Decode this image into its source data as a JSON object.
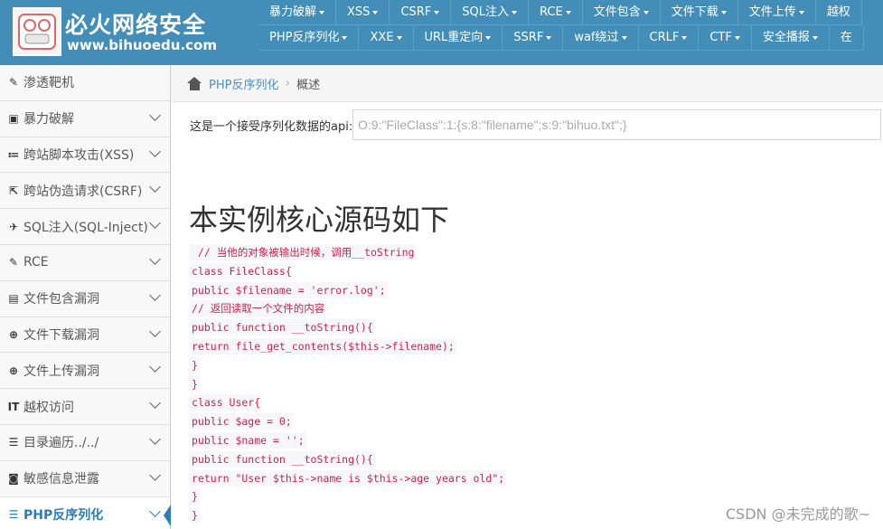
{
  "logo": {
    "title_cn": "必火网络安全",
    "url": "www.bihuoedu.com",
    "badge": "必火"
  },
  "top_nav": {
    "row1": [
      "暴力破解",
      "XSS",
      "CSRF",
      "SQL注入",
      "RCE",
      "文件包含",
      "文件下载",
      "文件上传",
      "越权"
    ],
    "row2": [
      "PHP反序列化",
      "XXE",
      "URL重定向",
      "SSRF",
      "waf绕过",
      "CRLF",
      "CTF",
      "安全播报",
      "在"
    ]
  },
  "sidebar": {
    "items": [
      {
        "label": "渗透靶机",
        "icon": "tag-icon",
        "glyph": "✎"
      },
      {
        "label": "暴力破解",
        "icon": "lock-icon",
        "glyph": "▣"
      },
      {
        "label": "跨站脚本攻击(XSS)",
        "icon": "list-icon",
        "glyph": "≔"
      },
      {
        "label": "跨站伪造请求(CSRF)",
        "icon": "external-link-icon",
        "glyph": "⇱"
      },
      {
        "label": "SQL注入(SQL-Inject)",
        "icon": "plane-icon",
        "glyph": "✈"
      },
      {
        "label": "RCE",
        "icon": "pencil-icon",
        "glyph": "✎"
      },
      {
        "label": "文件包含漏洞",
        "icon": "file-icon",
        "glyph": "▤"
      },
      {
        "label": "文件下载漏洞",
        "icon": "download-icon",
        "glyph": "⊕"
      },
      {
        "label": "文件上传漏洞",
        "icon": "upload-icon",
        "glyph": "⊕"
      },
      {
        "label": "越权访问",
        "icon": "text-icon",
        "glyph": "IT"
      },
      {
        "label": "目录遍历../../",
        "icon": "list-ul-icon",
        "glyph": "☰"
      },
      {
        "label": "敏感信息泄露",
        "icon": "camera-icon",
        "glyph": "◙"
      },
      {
        "label": "PHP反序列化",
        "icon": "list-ul-icon",
        "glyph": "☰",
        "active": true
      }
    ]
  },
  "breadcrumb": {
    "link": "PHP反序列化",
    "separator": "›",
    "current": "概述"
  },
  "main": {
    "api_label": "这是一个接受序列化数据的api:",
    "api_placeholder": "O:9:\"FileClass\":1:{s:8:\"filename\";s:9:\"bihuo.txt\";}",
    "heading": "本实例核心源码如下",
    "code_lines": [
      " // 当他的对象被输出时候，调用__toString",
      "class FileClass{",
      "public $filename = 'error.log';",
      "// 返回读取一个文件的内容",
      "public function __toString(){",
      "return file_get_contents($this->filename);",
      "}",
      "}",
      "class User{",
      "public $age = 0;",
      "public $name = '';",
      "public function __toString(){",
      "return \"User $this->name is $this->age years old\";",
      "}",
      "}"
    ]
  },
  "watermark": "CSDN @未完成的歌~",
  "colors": {
    "header_bg": "#438eb9",
    "accent": "#2b7dbc",
    "code_fg": "#c7254e",
    "code_bg": "#f7f7f9"
  }
}
